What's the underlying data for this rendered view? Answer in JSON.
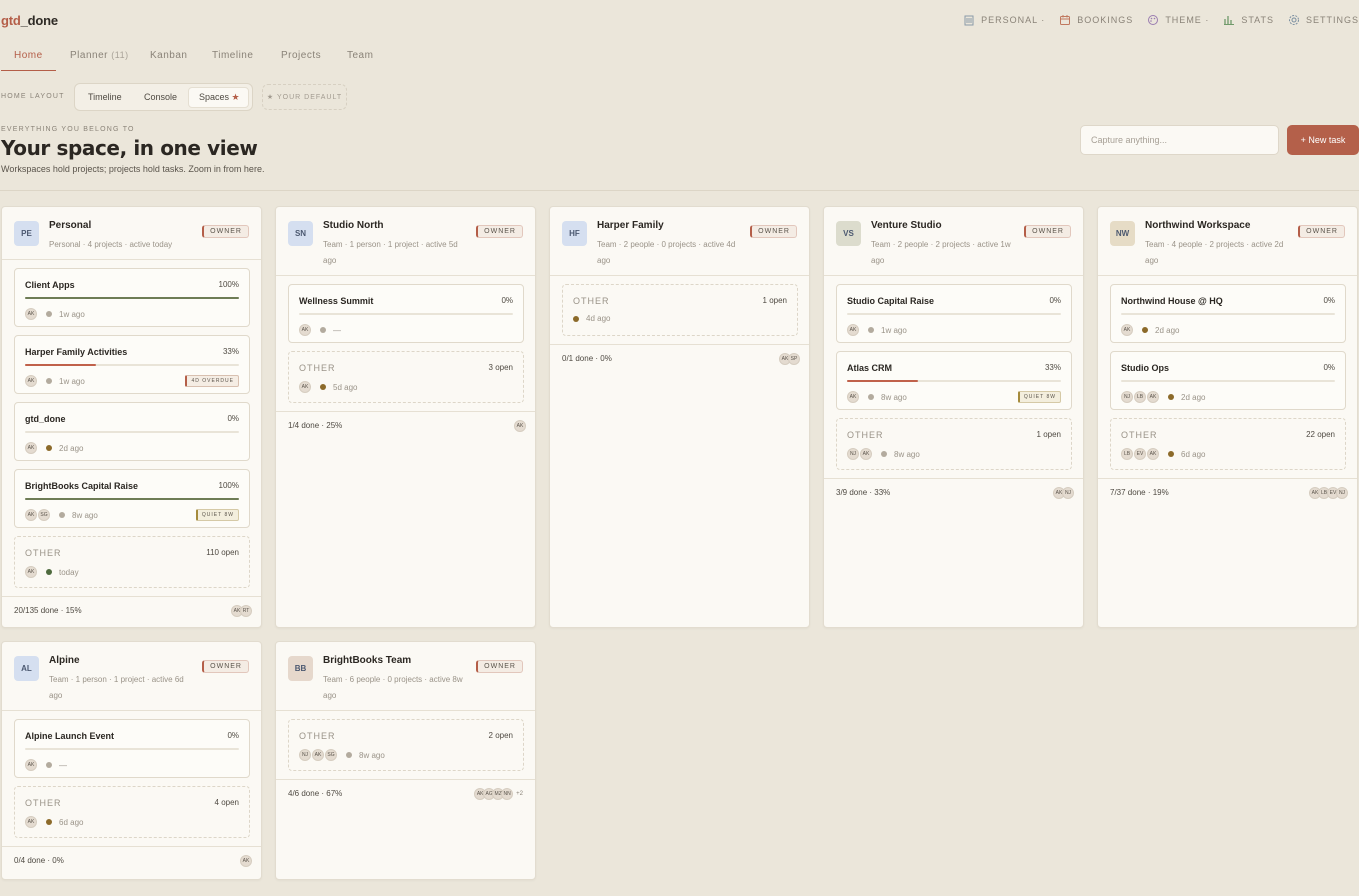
{
  "app": {
    "brand_prefix": "gtd",
    "brand_suffix": "_done"
  },
  "topnav": {
    "personal": "PERSONAL ·",
    "bookings": "BOOKINGS",
    "theme": "THEME ·",
    "stats": "STATS",
    "settings": "SETTINGS"
  },
  "tabs": {
    "home": "Home",
    "planner": "Planner",
    "planner_count": "(11)",
    "kanban": "Kanban",
    "timeline": "Timeline",
    "projects": "Projects",
    "team": "Team"
  },
  "layout": {
    "label": "HOME LAYOUT",
    "timeline": "Timeline",
    "console": "Console",
    "spaces": "Spaces",
    "star": "★",
    "default": "★ YOUR DEFAULT"
  },
  "hero": {
    "eyebrow": "EVERYTHING YOU BELONG TO",
    "title": "Your space, in one view",
    "subtitle": "Workspaces hold projects; projects hold tasks. Zoom in from here."
  },
  "capture": {
    "placeholder": "Capture anything..."
  },
  "new_task": "+ New task",
  "owner_label": "OWNER",
  "cards": {
    "personal": {
      "initials": "PE",
      "name": "Personal",
      "meta": "Personal · 4 projects · active today",
      "projects": [
        {
          "name": "Client Apps",
          "pct": "100%",
          "avatars": [
            "AK"
          ],
          "ago": "1w ago"
        },
        {
          "name": "Harper Family Activities",
          "pct": "33%",
          "avatars": [
            "AK"
          ],
          "ago": "1w ago",
          "tag": "4D OVERDUE"
        },
        {
          "name": "gtd_done",
          "pct": "0%",
          "avatars": [
            "AK"
          ],
          "ago": "2d ago"
        },
        {
          "name": "BrightBooks Capital Raise",
          "pct": "100%",
          "avatars": [
            "AK",
            "SG"
          ],
          "ago": "8w ago",
          "tag": "QUIET 8W"
        }
      ],
      "other": {
        "label": "OTHER",
        "count": "110 open",
        "avatars": [
          "AK"
        ],
        "ago": "today"
      },
      "footer": "20/135 done · 15%",
      "footer_avatars": [
        "AK",
        "RT"
      ]
    },
    "studio_north": {
      "initials": "SN",
      "name": "Studio North",
      "meta": "Team · 1 person · 1 project · active 5d ago",
      "projects": [
        {
          "name": "Wellness Summit",
          "pct": "0%",
          "avatars": [
            "AK"
          ],
          "ago": "—"
        }
      ],
      "other": {
        "label": "OTHER",
        "count": "3 open",
        "avatars": [
          "AK"
        ],
        "ago": "5d ago"
      },
      "footer": "1/4 done · 25%",
      "footer_avatars": [
        "AK"
      ]
    },
    "harper": {
      "initials": "HF",
      "name": "Harper Family",
      "meta": "Team · 2 people · 0 projects · active 4d ago",
      "other": {
        "label": "OTHER",
        "count": "1 open",
        "ago": "4d ago"
      },
      "footer": "0/1 done · 0%",
      "footer_avatars": [
        "AK",
        "SP"
      ]
    },
    "venture": {
      "initials": "VS",
      "name": "Venture Studio",
      "meta": "Team · 2 people · 2 projects · active 1w ago",
      "projects": [
        {
          "name": "Studio Capital Raise",
          "pct": "0%",
          "avatars": [
            "AK"
          ],
          "ago": "1w ago"
        },
        {
          "name": "Atlas CRM",
          "pct": "33%",
          "avatars": [
            "AK"
          ],
          "ago": "8w ago",
          "tag": "QUIET 8W"
        }
      ],
      "other": {
        "label": "OTHER",
        "count": "1 open",
        "avatars": [
          "NJ",
          "AK"
        ],
        "ago": "8w ago"
      },
      "footer": "3/9 done · 33%",
      "footer_avatars": [
        "AK",
        "NJ"
      ]
    },
    "northwind": {
      "initials": "NW",
      "name": "Northwind Workspace",
      "meta": "Team · 4 people · 2 projects · active 2d ago",
      "projects": [
        {
          "name": "Northwind House @ HQ",
          "pct": "0%",
          "avatars": [
            "AK"
          ],
          "ago": "2d ago"
        },
        {
          "name": "Studio Ops",
          "pct": "0%",
          "avatars": [
            "NJ",
            "LB",
            "AK"
          ],
          "ago": "2d ago"
        }
      ],
      "other": {
        "label": "OTHER",
        "count": "22 open",
        "avatars": [
          "LB",
          "EV",
          "AK"
        ],
        "ago": "6d ago"
      },
      "footer": "7/37 done · 19%",
      "footer_avatars": [
        "AK",
        "LB",
        "EV",
        "NJ"
      ]
    },
    "alpine": {
      "initials": "AL",
      "name": "Alpine",
      "meta": "Team · 1 person · 1 project · active 6d ago",
      "projects": [
        {
          "name": "Alpine Launch Event",
          "pct": "0%",
          "avatars": [
            "AK"
          ],
          "ago": "—"
        }
      ],
      "other": {
        "label": "OTHER",
        "count": "4 open",
        "avatars": [
          "AK"
        ],
        "ago": "6d ago"
      },
      "footer": "0/4 done · 0%",
      "footer_avatars": [
        "AK"
      ]
    },
    "brightbooks": {
      "initials": "BB",
      "name": "BrightBooks Team",
      "meta": "Team · 6 people · 0 projects · active 8w ago",
      "other": {
        "label": "OTHER",
        "count": "2 open",
        "avatars": [
          "NJ",
          "AK",
          "SG"
        ],
        "ago": "8w ago"
      },
      "footer": "4/6 done · 67%",
      "footer_avatars": [
        "AK",
        "AG",
        "MZ",
        "NN"
      ],
      "footer_more": "+2"
    }
  },
  "colors": {
    "accent": "#b45e48",
    "progress_full": "#6e7c55",
    "progress_partial": "#c0614b"
  }
}
